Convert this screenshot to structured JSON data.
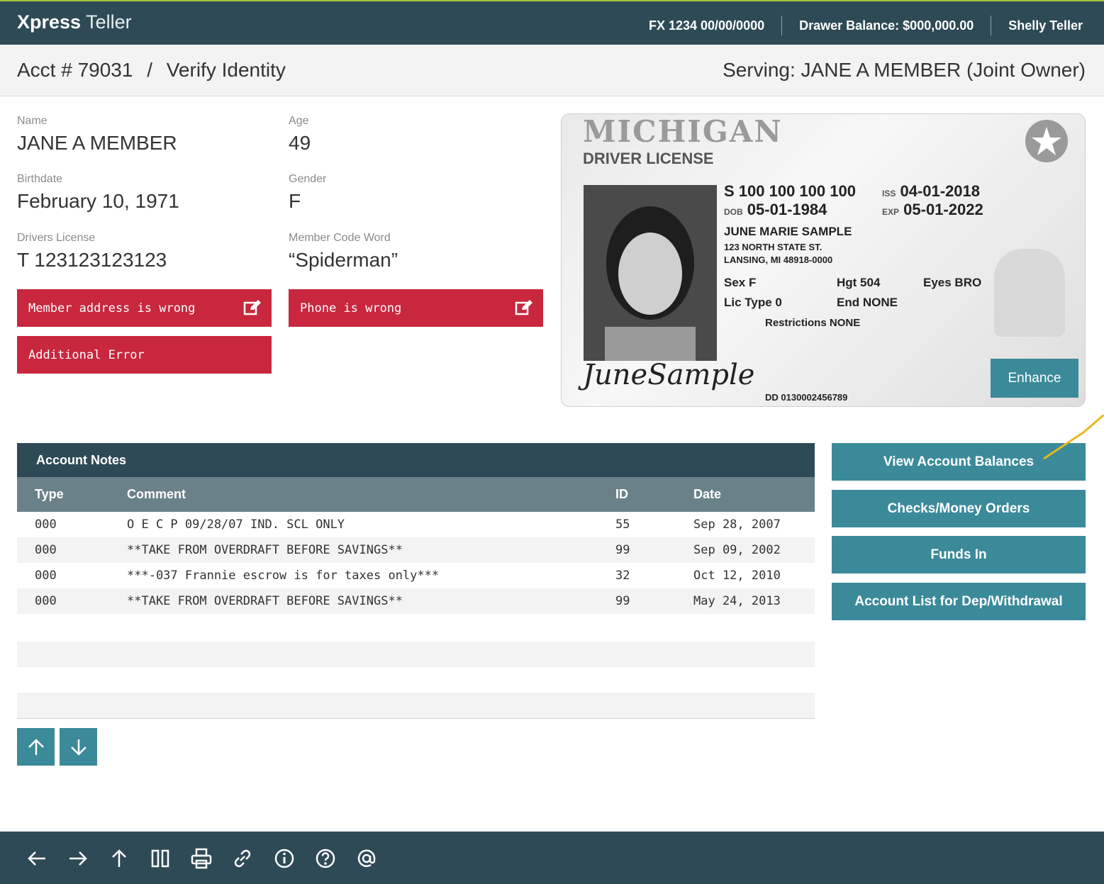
{
  "header": {
    "brand_bold": "Xpress",
    "brand_light": "Teller",
    "fx": "FX 1234 00/00/0000",
    "drawer_balance": "Drawer Balance: $000,000.00",
    "user": "Shelly Teller"
  },
  "breadcrumb": {
    "account": "Acct # 79031",
    "separator": "/",
    "page": "Verify Identity",
    "serving": "Serving: JANE A MEMBER (Joint Owner)"
  },
  "member": {
    "name_label": "Name",
    "name": "JANE A MEMBER",
    "age_label": "Age",
    "age": "49",
    "birthdate_label": "Birthdate",
    "birthdate": "February 10, 1971",
    "gender_label": "Gender",
    "gender": "F",
    "license_label": "Drivers License",
    "license": "T 123123123123",
    "codeword_label": "Member Code Word",
    "codeword": "“Spiderman”"
  },
  "errors": {
    "address": "Member address is wrong",
    "phone": "Phone is wrong",
    "additional": "Additional Error"
  },
  "license_card": {
    "state": "MICHIGAN",
    "type": "DRIVER LICENSE",
    "number": "S 100 100 100 100",
    "dob_label": "DOB",
    "dob": "05-01-1984",
    "iss_label": "ISS",
    "iss": "04-01-2018",
    "exp_label": "EXP",
    "exp": "05-01-2022",
    "holder_name": "JUNE MARIE SAMPLE",
    "address1": "123 NORTH STATE ST.",
    "address2": "LANSING, MI 48918-0000",
    "sex": "Sex F",
    "hgt": "Hgt 504",
    "eyes": "Eyes BRO",
    "lic_type": "Lic Type 0",
    "end": "End NONE",
    "restrictions": "Restrictions NONE",
    "signature": "JuneSample",
    "dd": "DD 0130002456789",
    "enhance_label": "Enhance"
  },
  "notes": {
    "title": "Account Notes",
    "columns": [
      "Type",
      "Comment",
      "ID",
      "Date"
    ],
    "rows": [
      {
        "type": "000",
        "comment": "O E C P 09/28/07 IND. SCL ONLY",
        "id": "55",
        "date": "Sep 28, 2007"
      },
      {
        "type": "000",
        "comment": "**TAKE FROM OVERDRAFT BEFORE SAVINGS**",
        "id": "99",
        "date": "Sep 09, 2002"
      },
      {
        "type": "000",
        "comment": "***-037 Frannie escrow is for taxes only***",
        "id": "32",
        "date": "Oct 12, 2010"
      },
      {
        "type": "000",
        "comment": "**TAKE FROM OVERDRAFT BEFORE SAVINGS**",
        "id": "99",
        "date": "May 24, 2013"
      }
    ]
  },
  "actions": {
    "view_balances": "View Account Balances",
    "checks": "Checks/Money Orders",
    "funds_in": "Funds In",
    "account_list": "Account List for Dep/Withdrawal"
  },
  "colors": {
    "header_bg": "#2f4a57",
    "accent": "#3b8a9a",
    "error": "#c8273e",
    "table_head": "#6b818a"
  },
  "footer_icons": [
    "arrow-left-icon",
    "arrow-right-icon",
    "arrow-up-icon",
    "columns-icon",
    "print-icon",
    "link-icon",
    "info-icon",
    "help-icon",
    "at-icon"
  ]
}
